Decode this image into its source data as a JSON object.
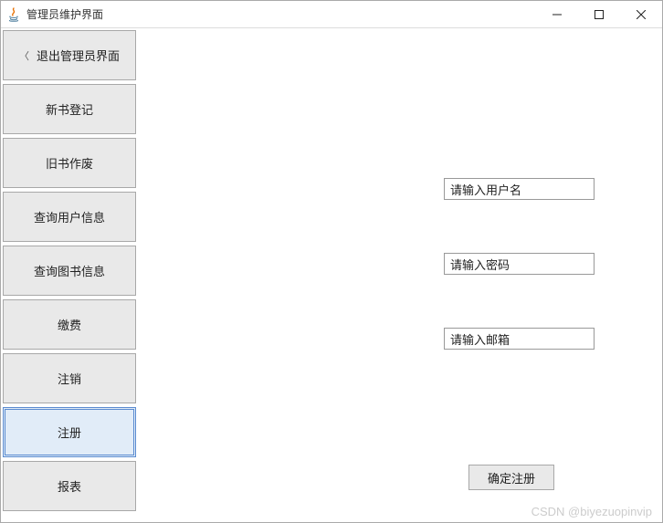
{
  "window": {
    "title": "管理员维护界面"
  },
  "sidebar": {
    "items": [
      {
        "label": "退出管理员界面",
        "hasBack": true,
        "selected": false
      },
      {
        "label": "新书登记",
        "hasBack": false,
        "selected": false
      },
      {
        "label": "旧书作废",
        "hasBack": false,
        "selected": false
      },
      {
        "label": "查询用户信息",
        "hasBack": false,
        "selected": false
      },
      {
        "label": "查询图书信息",
        "hasBack": false,
        "selected": false
      },
      {
        "label": "缴费",
        "hasBack": false,
        "selected": false
      },
      {
        "label": "注销",
        "hasBack": false,
        "selected": false
      },
      {
        "label": "注册",
        "hasBack": false,
        "selected": true
      },
      {
        "label": "报表",
        "hasBack": false,
        "selected": false
      }
    ]
  },
  "form": {
    "username_placeholder": "请输入用户名",
    "password_placeholder": "请输入密码",
    "email_placeholder": "请输入邮箱",
    "confirm_label": "确定注册"
  },
  "watermark": "CSDN @biyezuopinvip"
}
